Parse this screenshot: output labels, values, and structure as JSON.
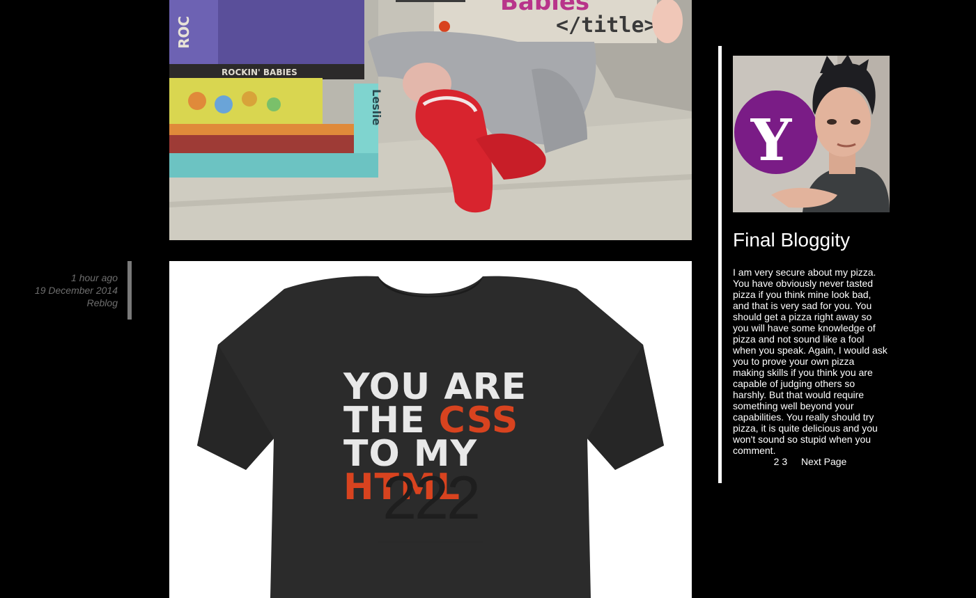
{
  "post": {
    "time_ago": "1 hour ago",
    "date": "19 December 2014",
    "reblog_label": "Reblog"
  },
  "photo_baby": {
    "book_text": "Babies",
    "sign_text": "</title>",
    "spine_text": "ROCKIN' BABIES",
    "spine_left": "ROC",
    "side_text": "Leslie"
  },
  "photo_shirt": {
    "line1": "YOU ARE",
    "line2_white": "THE ",
    "line2_red": "CSS",
    "line3": "TO MY",
    "line4": "HTML",
    "overlay_number": "222",
    "colors": {
      "shirt": "#2b2b2b",
      "text_white": "#e8e8e8",
      "text_red": "#d8431f"
    }
  },
  "sidebar": {
    "avatar_letter": "Y",
    "blog_title": "Final Bloggity",
    "description": "I am very secure about my pizza. You have obviously never tasted pizza if you think mine look bad, and that is very sad for you. You should get a pizza right away so you will have some knowledge of pizza and not sound like a fool when you speak. Again, I would ask you to prove your own pizza making skills if you think you are capable of judging others so harshly. But that would require something well beyond your capabilities. You really should try pizza, it is quite delicious and you won't sound so stupid when you comment."
  },
  "pagination": {
    "page_2": "2",
    "page_3": "3",
    "next_label": "Next Page"
  },
  "colors": {
    "background": "#000000",
    "meta_text": "#6e6e6e",
    "avatar_purple": "#7a1c86"
  }
}
